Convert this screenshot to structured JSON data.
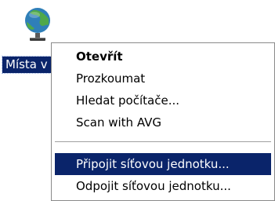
{
  "desktop": {
    "icon": {
      "name": "network-places-icon",
      "label": "Místa v síti"
    }
  },
  "context_menu": {
    "items": [
      {
        "label": "Otevřít",
        "bold": true
      },
      {
        "label": "Prozkoumat"
      },
      {
        "label": "Hledat počítače..."
      },
      {
        "label": "Scan with AVG"
      },
      {
        "label": "Připojit síťovou jednotku...",
        "selected": true
      },
      {
        "label": "Odpojit síťovou jednotku..."
      }
    ]
  },
  "colors": {
    "selection": "#0a246a",
    "menu_border": "#8a8a8a",
    "background": "#ffffff"
  }
}
